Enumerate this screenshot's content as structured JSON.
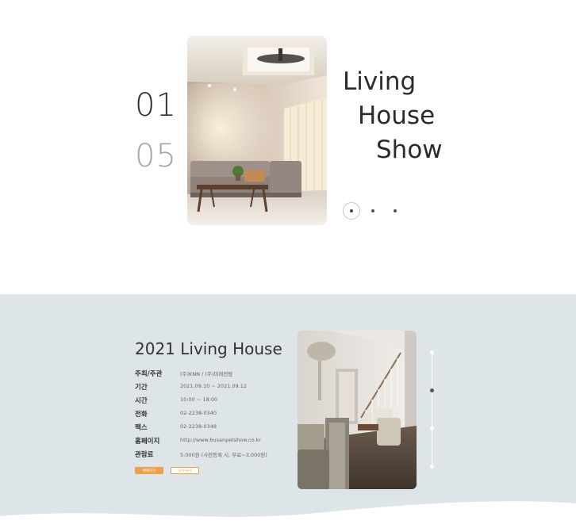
{
  "hero": {
    "current": "01",
    "total": "05",
    "title_lines": [
      "Living",
      "House",
      "Show"
    ],
    "slides": 3,
    "active_slide": 1
  },
  "info": {
    "title": "2021 Living House",
    "rows": [
      {
        "label": "주최/주관",
        "value": "(주)KNN / (주)미래전람"
      },
      {
        "label": "기간",
        "value": "2021.09.10 ~ 2021.09.12"
      },
      {
        "label": "시간",
        "value": "10:00 ~ 18:00"
      },
      {
        "label": "전화",
        "value": "02-2238-0340"
      },
      {
        "label": "팩스",
        "value": "02-2238-0348"
      },
      {
        "label": "홈페이지",
        "value": "http://www.busanpetshow.co.kr"
      },
      {
        "label": "관람료",
        "value": "5,000원 (사전등록 시, 무료~3,000원)"
      }
    ],
    "buttons": {
      "reserve": "예매하기",
      "group": "공유하기"
    },
    "pager_count": 4,
    "pager_active": 2
  },
  "colors": {
    "accent": "#e9a14c",
    "section_bg": "#dde5e8",
    "text": "#333333"
  }
}
